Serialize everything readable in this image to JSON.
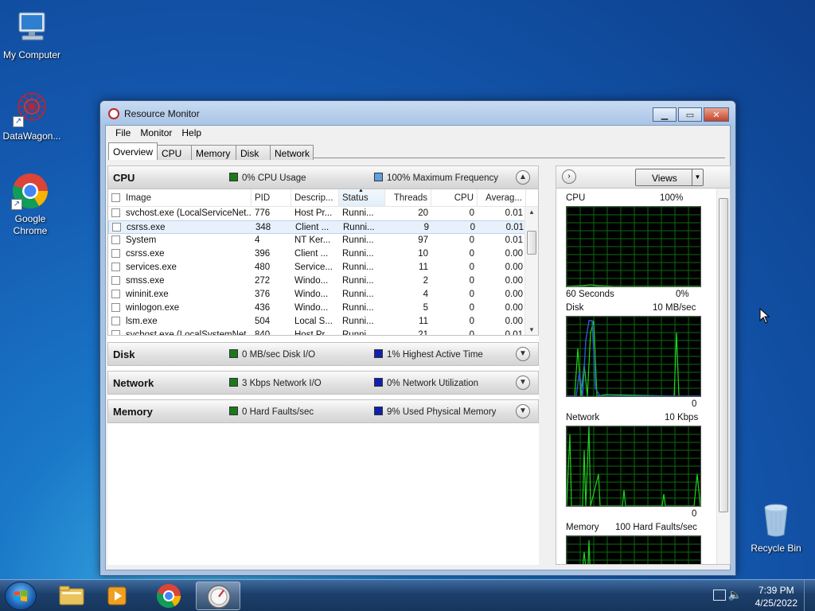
{
  "desktop": {
    "icons": [
      {
        "label": "My Computer",
        "icon": "computer-icon"
      },
      {
        "label": "DataWagon...",
        "icon": "datawagon-icon"
      },
      {
        "label": "Google Chrome",
        "icon": "chrome-icon"
      },
      {
        "label": "Recycle Bin",
        "icon": "recycle-bin-icon"
      }
    ]
  },
  "window": {
    "title": "Resource Monitor",
    "menu": [
      "File",
      "Monitor",
      "Help"
    ],
    "tabs": [
      "Overview",
      "CPU",
      "Memory",
      "Disk",
      "Network"
    ],
    "active_tab": "Overview"
  },
  "cpu_section": {
    "name": "CPU",
    "stat1": "0% CPU Usage",
    "stat1_color": "#1a7a1a",
    "stat2": "100% Maximum Frequency",
    "stat2_color": "#5fa0e0",
    "columns": [
      "Image",
      "PID",
      "Descrip...",
      "Status",
      "Threads",
      "CPU",
      "Averag..."
    ],
    "rows": [
      [
        "svchost.exe (LocalServiceNet...",
        "776",
        "Host Pr...",
        "Runni...",
        "20",
        "0",
        "0.01"
      ],
      [
        "csrss.exe",
        "348",
        "Client ...",
        "Runni...",
        "9",
        "0",
        "0.01"
      ],
      [
        "System",
        "4",
        "NT Ker...",
        "Runni...",
        "97",
        "0",
        "0.01"
      ],
      [
        "csrss.exe",
        "396",
        "Client ...",
        "Runni...",
        "10",
        "0",
        "0.00"
      ],
      [
        "services.exe",
        "480",
        "Service...",
        "Runni...",
        "11",
        "0",
        "0.00"
      ],
      [
        "smss.exe",
        "272",
        "Windo...",
        "Runni...",
        "2",
        "0",
        "0.00"
      ],
      [
        "wininit.exe",
        "376",
        "Windo...",
        "Runni...",
        "4",
        "0",
        "0.00"
      ],
      [
        "winlogon.exe",
        "436",
        "Windo...",
        "Runni...",
        "5",
        "0",
        "0.00"
      ],
      [
        "lsm.exe",
        "504",
        "Local S...",
        "Runni...",
        "11",
        "0",
        "0.00"
      ],
      [
        "svchost.exe (LocalSystemNet...",
        "840",
        "Host Pr...",
        "Runni...",
        "21",
        "0",
        "0.01"
      ]
    ],
    "selected_row": 1
  },
  "disk_section": {
    "name": "Disk",
    "stat1": "0 MB/sec Disk I/O",
    "stat1_color": "#1a7a1a",
    "stat2": "1% Highest Active Time",
    "stat2_color": "#1020b0"
  },
  "network_section": {
    "name": "Network",
    "stat1": "3 Kbps Network I/O",
    "stat1_color": "#1a7a1a",
    "stat2": "0% Network Utilization",
    "stat2_color": "#1020b0"
  },
  "memory_section": {
    "name": "Memory",
    "stat1": "0 Hard Faults/sec",
    "stat1_color": "#1a7a1a",
    "stat2": "9% Used Physical Memory",
    "stat2_color": "#1020b0"
  },
  "graphs": {
    "views_label": "Views",
    "cpu": {
      "title": "CPU",
      "max": "100%",
      "bottom_left": "60 Seconds",
      "bottom_right": "0%"
    },
    "disk": {
      "title": "Disk",
      "max": "10 MB/sec",
      "bottom_right": "0"
    },
    "network": {
      "title": "Network",
      "max": "10 Kbps",
      "bottom_right": "0"
    },
    "memory": {
      "title": "Memory",
      "max": "100 Hard Faults/sec"
    }
  },
  "taskbar": {
    "time": "7:39 PM",
    "date": "4/25/2022"
  }
}
